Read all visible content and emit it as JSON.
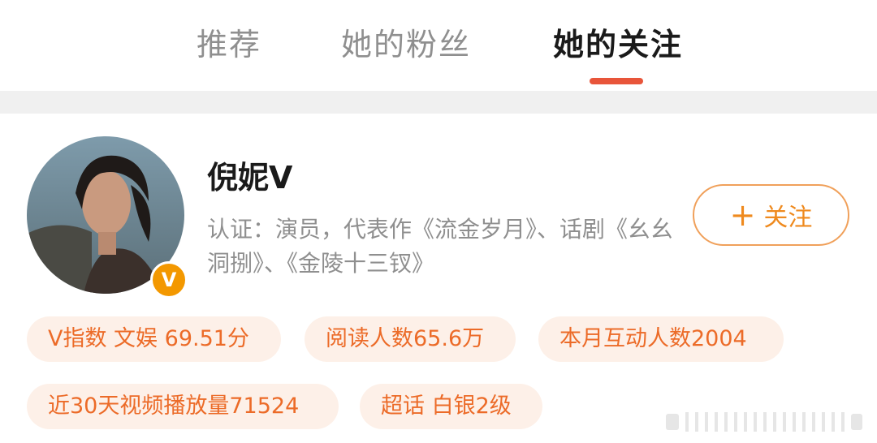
{
  "tabs": [
    {
      "label": "推荐",
      "active": false
    },
    {
      "label": "她的粉丝",
      "active": false
    },
    {
      "label": "她的关注",
      "active": true
    }
  ],
  "profile": {
    "name": "倪妮V",
    "verification": "认证：演员，代表作《流金岁月》、话剧《幺幺洞捌》、《金陵十三钗》",
    "badge": "V",
    "follow_label": "关注"
  },
  "tags": [
    "V指数 文娱 69.51分",
    "阅读人数65.6万",
    "本月互动人数2004",
    "近30天视频播放量71524",
    "超话 白银2级"
  ],
  "colors": {
    "accent": "#e8553a",
    "tag_text": "#ec6b28",
    "tag_bg": "#fdf0e8",
    "badge": "#f39800"
  }
}
